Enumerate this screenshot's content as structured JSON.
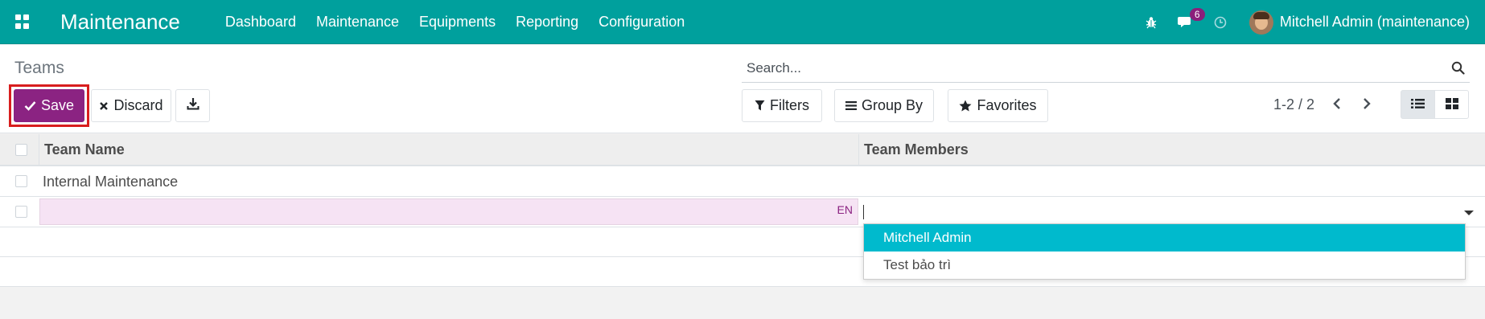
{
  "navbar": {
    "app_title": "Maintenance",
    "menu": [
      "Dashboard",
      "Maintenance",
      "Equipments",
      "Reporting",
      "Configuration"
    ],
    "messages_count": "6",
    "user_name": "Mitchell Admin (maintenance)"
  },
  "control_panel": {
    "breadcrumb": "Teams",
    "search_placeholder": "Search...",
    "save_label": "Save",
    "discard_label": "Discard",
    "filters_label": "Filters",
    "group_by_label": "Group By",
    "favorites_label": "Favorites",
    "pager": "1-2 / 2"
  },
  "table": {
    "columns": [
      "Team Name",
      "Team Members"
    ],
    "rows": [
      {
        "team_name": "Internal Maintenance",
        "team_members": ""
      }
    ],
    "editing_row": {
      "team_name_value": "",
      "lang_tag": "EN",
      "team_members_value": ""
    }
  },
  "autocomplete": {
    "options": [
      "Mitchell Admin",
      "Test bảo trì"
    ],
    "active_index": 0
  },
  "colors": {
    "navbar": "#00a09d",
    "primary": "#8b2382",
    "highlight": "#d81e1e",
    "active_option": "#00bacd"
  }
}
